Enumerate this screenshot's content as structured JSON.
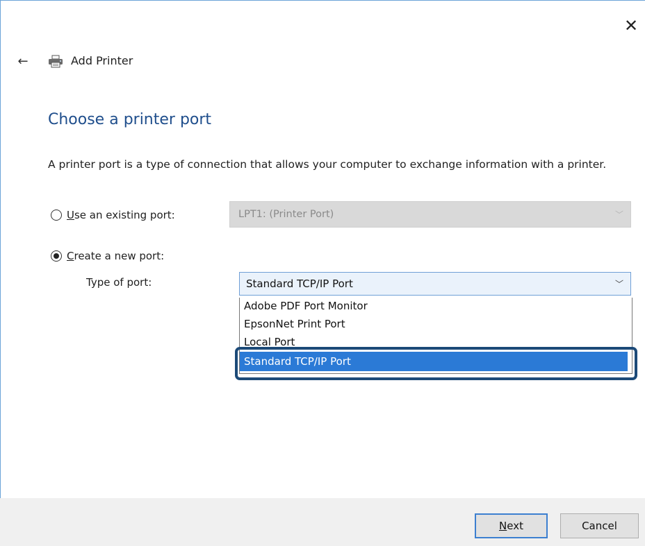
{
  "window": {
    "close_glyph": "✕"
  },
  "header": {
    "back_glyph": "←",
    "title": "Add Printer",
    "icon": "printer-icon"
  },
  "page": {
    "heading": "Choose a printer port",
    "description": "A printer port is a type of connection that allows your computer to exchange information with a printer."
  },
  "options": {
    "existing": {
      "label_access_key": "U",
      "label_rest": "se an existing port:",
      "selected": false,
      "value": "LPT1: (Printer Port)",
      "enabled": false
    },
    "new_port": {
      "label_access_key": "C",
      "label_rest": "reate a new port:",
      "selected": true
    }
  },
  "type_of_port": {
    "label": "Type of port:",
    "value": "Standard TCP/IP Port",
    "dropdown_open": true,
    "items": [
      "Adobe PDF Port Monitor",
      "EpsonNet Print Port",
      "Local Port",
      "Standard TCP/IP Port"
    ],
    "highlighted_item": "Standard TCP/IP Port"
  },
  "footer": {
    "next_access_key": "N",
    "next_rest": "ext",
    "cancel_label": "Cancel"
  },
  "colors": {
    "heading": "#1f4e8c",
    "selection": "#2b7ad6",
    "callout_border": "#1c4a78",
    "accent_border": "#6f9fd6"
  }
}
